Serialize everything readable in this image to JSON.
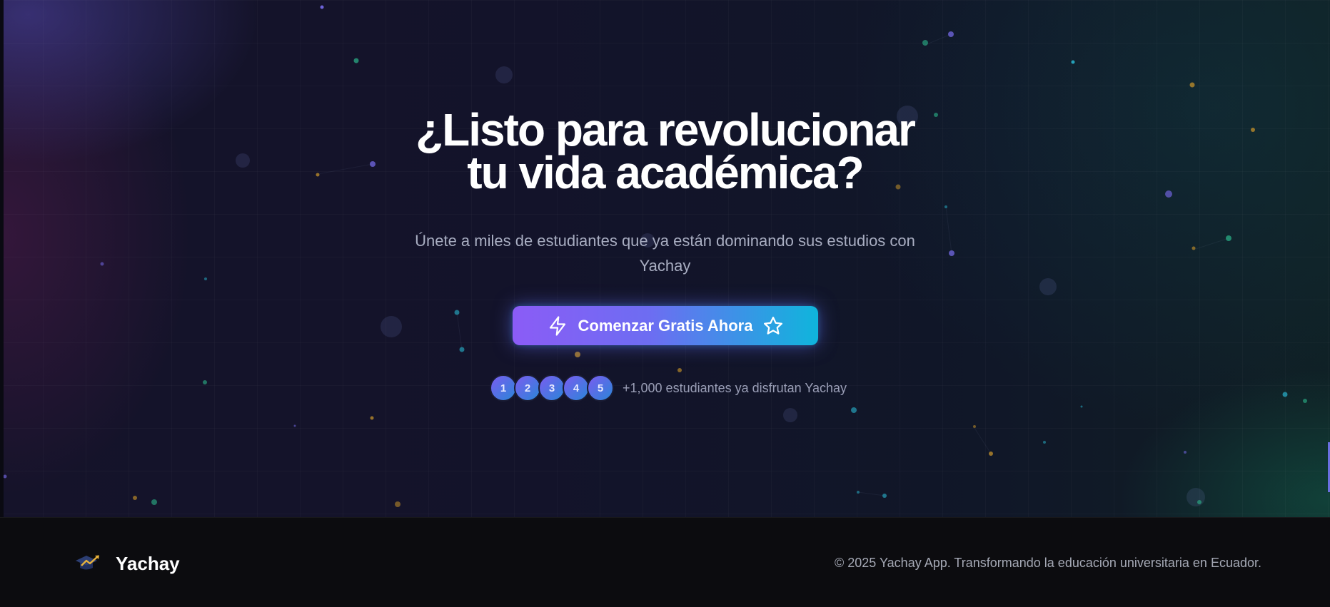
{
  "hero": {
    "title_line1": "¿Listo para revolucionar",
    "title_line2": "tu vida académica?",
    "subtitle_line1": "Únete a miles de estudiantes que ya están dominando sus estudios con",
    "subtitle_line2": "Yachay",
    "cta": {
      "label": "Comenzar Gratis Ahora",
      "icon_left": "lightning-icon",
      "icon_right": "star-icon",
      "gradient": [
        "#8b5cf6",
        "#0fb5dc"
      ]
    },
    "social_proof": {
      "avatars": [
        "1",
        "2",
        "3",
        "4",
        "5"
      ],
      "text": "+1,000 estudiantes ya disfrutan Yachay"
    }
  },
  "footer": {
    "logo_icon": "graduation-cap-trend-icon",
    "brand": "Yachay",
    "copyright": "© 2025 Yachay App. Transformando la educación universitaria en Ecuador."
  },
  "colors": {
    "background": "#0d0e1a",
    "footer_bg": "#0c0c0f",
    "accent_purple": "#8b5cf6",
    "accent_cyan": "#0fb5dc"
  }
}
